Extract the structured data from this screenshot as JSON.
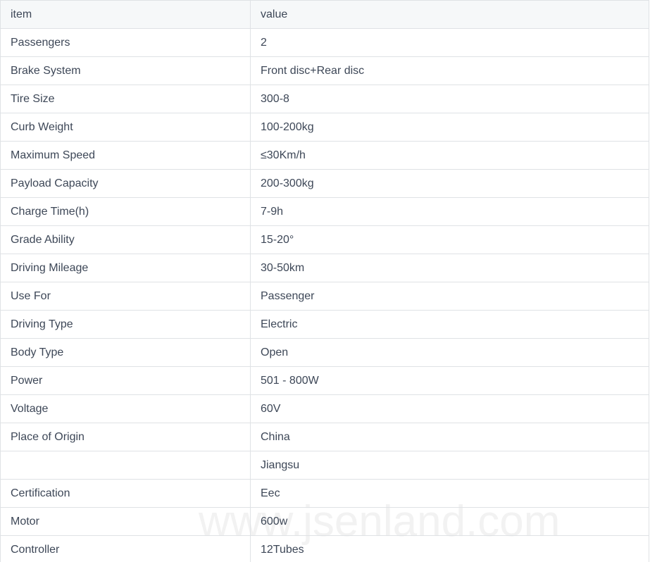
{
  "table": {
    "columns": [
      {
        "key": "item",
        "label": "item"
      },
      {
        "key": "value",
        "label": "value"
      }
    ],
    "rows": [
      {
        "item": "Passengers",
        "value": "2"
      },
      {
        "item": "Brake System",
        "value": "Front disc+Rear disc"
      },
      {
        "item": "Tire Size",
        "value": "300-8"
      },
      {
        "item": "Curb Weight",
        "value": "100-200kg"
      },
      {
        "item": "Maximum Speed",
        "value": "≤30Km/h"
      },
      {
        "item": "Payload Capacity",
        "value": "200-300kg"
      },
      {
        "item": "Charge Time(h)",
        "value": "7-9h"
      },
      {
        "item": "Grade Ability",
        "value": "15-20°"
      },
      {
        "item": "Driving Mileage",
        "value": "30-50km"
      },
      {
        "item": "Use For",
        "value": "Passenger"
      },
      {
        "item": "Driving Type",
        "value": "Electric"
      },
      {
        "item": "Body Type",
        "value": "Open"
      },
      {
        "item": "Power",
        "value": "501 - 800W"
      },
      {
        "item": "Voltage",
        "value": "60V"
      },
      {
        "item": "Place of Origin",
        "value": "China"
      },
      {
        "item": "",
        "value": "Jiangsu"
      },
      {
        "item": "Certification",
        "value": "Eec"
      },
      {
        "item": "Motor",
        "value": "600w"
      },
      {
        "item": "Controller",
        "value": "12Tubes"
      }
    ]
  },
  "watermark": {
    "text": "www.jsenland.com"
  },
  "colors": {
    "text": "#3d4757",
    "border": "#dfe2e5",
    "header_background": "#f6f8f9",
    "watermark": "#f2f2f2",
    "page_background": "#ffffff"
  }
}
